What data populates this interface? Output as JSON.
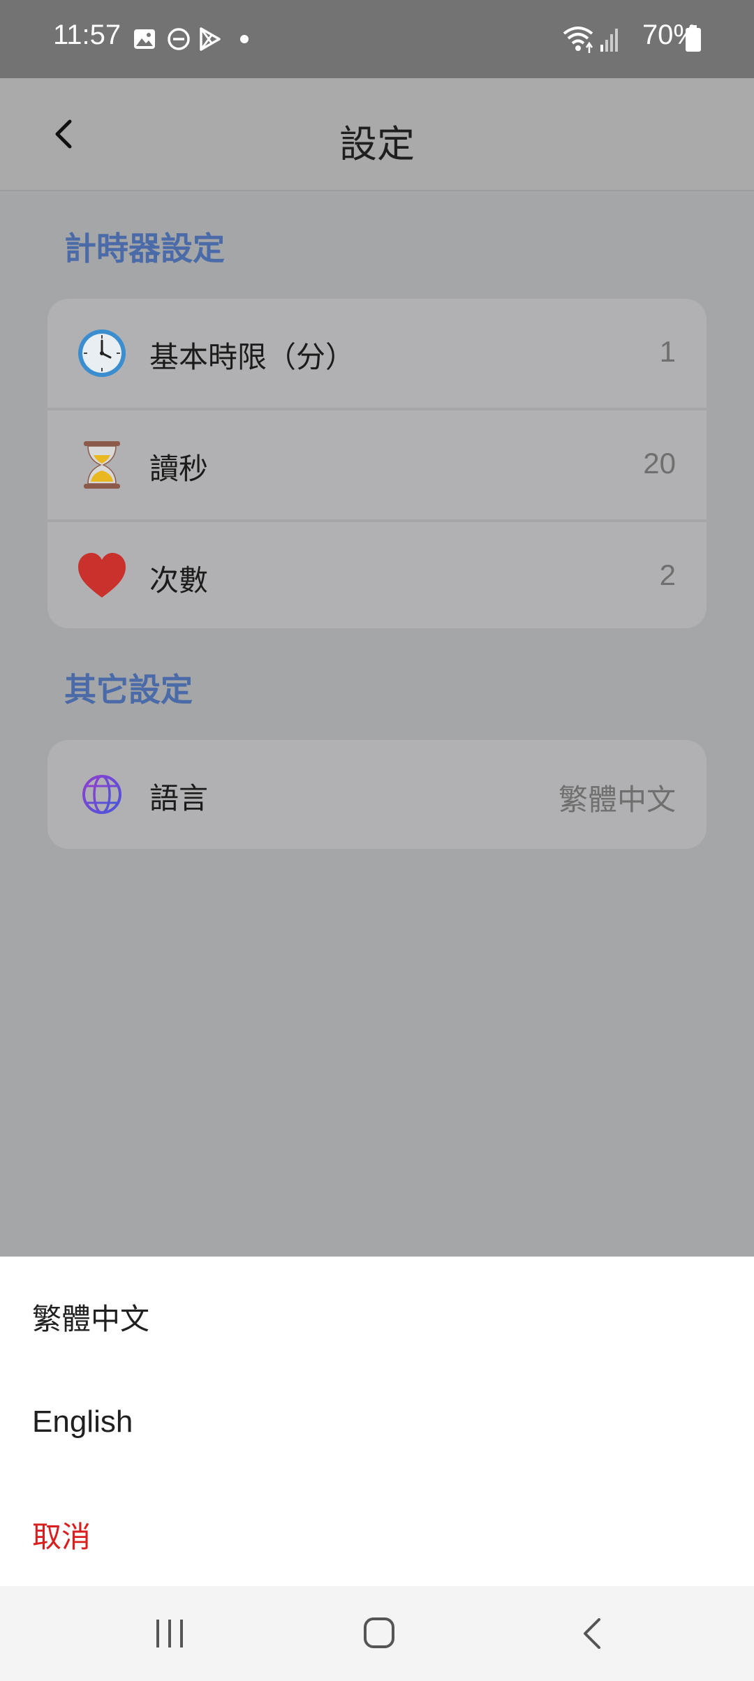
{
  "status_bar": {
    "time": "11:57",
    "battery": "70%",
    "icons": [
      "image-icon",
      "dnd-icon",
      "play-store-icon",
      "dot-icon",
      "wifi-icon",
      "signal-icon",
      "battery-icon"
    ]
  },
  "app_bar": {
    "title": "設定",
    "back_icon": "chevron-left-icon"
  },
  "sections": [
    {
      "title": "計時器設定",
      "rows": [
        {
          "icon": "clock-icon",
          "label": "基本時限（分）",
          "value": "1"
        },
        {
          "icon": "hourglass-icon",
          "label": "讀秒",
          "value": "20"
        },
        {
          "icon": "heart-icon",
          "label": "次數",
          "value": "2"
        }
      ]
    },
    {
      "title": "其它設定",
      "rows": [
        {
          "icon": "globe-icon",
          "label": "語言",
          "value": "繁體中文"
        }
      ]
    }
  ],
  "language_sheet": {
    "options": [
      "繁體中文",
      "English"
    ],
    "cancel": "取消"
  },
  "colors": {
    "section_title": "#4a6aa8",
    "cancel": "#d81e1e",
    "scrim": "#a5a6a8"
  },
  "nav_bar": {
    "icons": [
      "recents-icon",
      "home-icon",
      "back-icon"
    ]
  }
}
